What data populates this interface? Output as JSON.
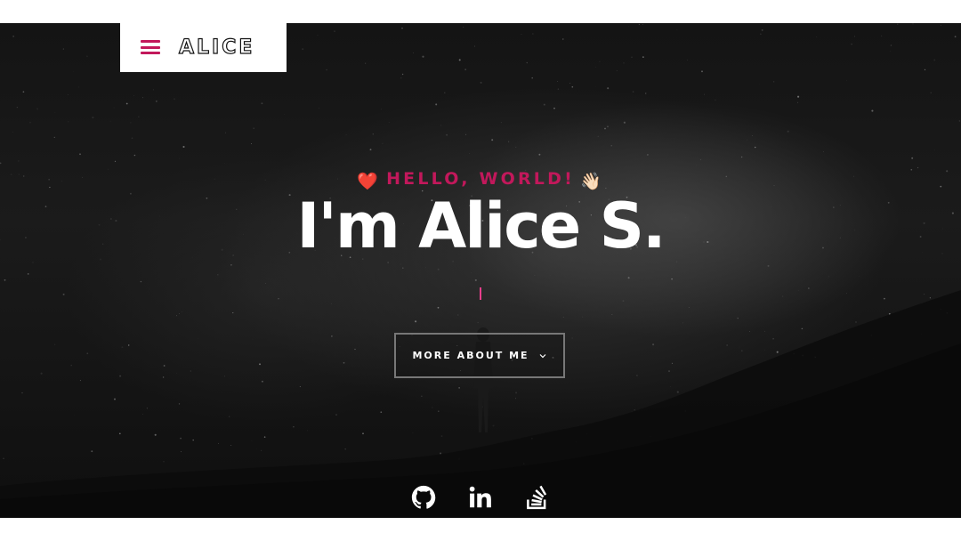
{
  "header": {
    "logo_text": "ALICE",
    "menu_icon": "hamburger-menu-icon",
    "accent_color": "#c2185b"
  },
  "hero": {
    "greeting": "HELLO, WORLD!",
    "greeting_emoji_left": "❤️",
    "greeting_emoji_right": "👋🏻",
    "heading": "I'm Alice S.",
    "cta_label": "MORE ABOUT ME",
    "cta_icon": "chevron-down-icon"
  },
  "social": {
    "links": [
      {
        "name": "github",
        "icon": "github-icon"
      },
      {
        "name": "linkedin",
        "icon": "linkedin-icon"
      },
      {
        "name": "stackoverflow",
        "icon": "stackoverflow-icon"
      }
    ]
  }
}
